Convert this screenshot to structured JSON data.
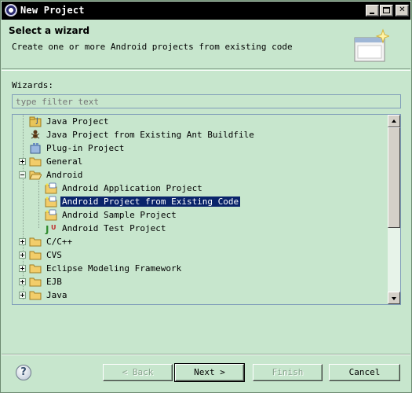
{
  "window": {
    "title": "New Project",
    "controls": {
      "minimize_icon": "minimize-icon",
      "maximize_icon": "maximize-icon",
      "close_glyph": "✕"
    }
  },
  "header": {
    "title": "Select a wizard",
    "description": "Create one or more Android projects from existing code",
    "graphic_icon": "new-wizard-banner-icon"
  },
  "wizards_label": "Wizards:",
  "filter": {
    "placeholder": "type filter text",
    "value": ""
  },
  "tree": {
    "items": [
      {
        "label": "Java Project",
        "icon": "java-project-icon",
        "expander": "none",
        "depth": 1
      },
      {
        "label": "Java Project from Existing Ant Buildfile",
        "icon": "ant-icon",
        "expander": "none",
        "depth": 1
      },
      {
        "label": "Plug-in Project",
        "icon": "plugin-project-icon",
        "expander": "none",
        "depth": 1
      },
      {
        "label": "General",
        "icon": "folder-icon",
        "expander": "plus",
        "depth": 1
      },
      {
        "label": "Android",
        "icon": "folder-open-icon",
        "expander": "minus",
        "depth": 1
      },
      {
        "label": "Android Application Project",
        "icon": "android-project-icon",
        "expander": "none",
        "depth": 2
      },
      {
        "label": "Android Project from Existing Code",
        "icon": "android-project-icon",
        "expander": "none",
        "depth": 2,
        "selected": true
      },
      {
        "label": "Android Sample Project",
        "icon": "android-project-icon",
        "expander": "none",
        "depth": 2
      },
      {
        "label": "Android Test Project",
        "icon": "junit-icon",
        "expander": "none",
        "depth": 2
      },
      {
        "label": "C/C++",
        "icon": "folder-icon",
        "expander": "plus",
        "depth": 1
      },
      {
        "label": "CVS",
        "icon": "folder-icon",
        "expander": "plus",
        "depth": 1
      },
      {
        "label": "Eclipse Modeling Framework",
        "icon": "folder-icon",
        "expander": "plus",
        "depth": 1
      },
      {
        "label": "EJB",
        "icon": "folder-icon",
        "expander": "plus",
        "depth": 1
      },
      {
        "label": "Java",
        "icon": "folder-icon",
        "expander": "plus",
        "depth": 1
      }
    ]
  },
  "buttons": {
    "help_glyph": "?",
    "back": "< Back",
    "next": "Next >",
    "finish": "Finish",
    "cancel": "Cancel"
  },
  "colors": {
    "background": "#c7e6cd",
    "selection": "#0a246a",
    "title_bar": "#000000"
  }
}
